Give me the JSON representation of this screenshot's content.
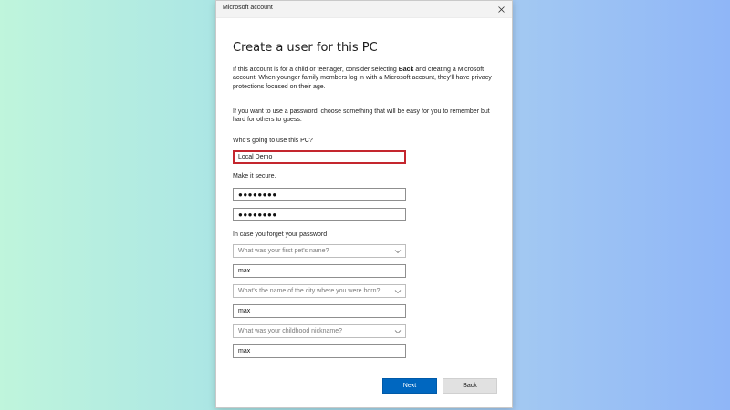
{
  "window": {
    "title": "Microsoft account"
  },
  "page": {
    "heading": "Create a user for this PC",
    "intro_before_bold": "If this account is for a child or teenager, consider selecting ",
    "intro_bold": "Back",
    "intro_after_bold": " and creating a Microsoft account. When younger family members log in with a Microsoft account, they'll have privacy protections focused on their age.",
    "password_hint": "If you want to use a password, choose something that will be easy for you to remember but hard for others to guess."
  },
  "form": {
    "who_label": "Who's going to use this PC?",
    "username_value": "Local Demo",
    "secure_label": "Make it secure.",
    "password_value": "●●●●●●●●",
    "confirm_password_value": "●●●●●●●●",
    "forget_label": "In case you forget your password",
    "questions": [
      {
        "placeholder": "What was your first pet's name?",
        "answer": "max"
      },
      {
        "placeholder": "What's the name of the city where you were born?",
        "answer": "max"
      },
      {
        "placeholder": "What was your childhood nickname?",
        "answer": "max"
      }
    ]
  },
  "buttons": {
    "next": "Next",
    "back": "Back"
  },
  "colors": {
    "accent": "#0067c0",
    "focus_border": "#c4262e"
  }
}
